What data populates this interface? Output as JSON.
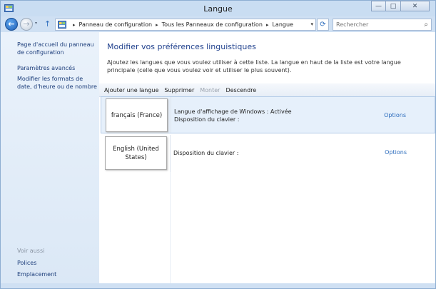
{
  "window": {
    "title": "Langue",
    "minimize": "—",
    "maximize": "□",
    "close": "✕"
  },
  "nav": {
    "back_glyph": "←",
    "forward_glyph": "→",
    "recent_glyph": "▾",
    "up_glyph": "↑",
    "refresh_glyph": "⟳",
    "breadcrumbs": [
      "Panneau de configuration",
      "Tous les Panneaux de configuration",
      "Langue"
    ],
    "separator": "▸",
    "dropdown_glyph": "▾",
    "search_placeholder": "Rechercher",
    "search_glyph": "⌕"
  },
  "sidebar": {
    "links": [
      "Page d'accueil du panneau de configuration",
      "Paramètres avancés",
      "Modifier les formats de date, d'heure ou de nombre"
    ],
    "see_also_title": "Voir aussi",
    "see_also_links": [
      "Polices",
      "Emplacement"
    ]
  },
  "main": {
    "heading": "Modifier vos préférences linguistiques",
    "description": "Ajoutez les langues que vous voulez utiliser à cette liste. La langue en haut de la liste est votre langue principale (celle que vous voulez voir et utiliser le plus souvent).",
    "toolbar": {
      "add": "Ajouter une langue",
      "remove": "Supprimer",
      "up": "Monter",
      "down": "Descendre"
    },
    "languages": [
      {
        "name": "français (France)",
        "display_language": "Langue d'affichage de Windows : Activée",
        "keyboard": "Disposition du clavier :",
        "options": "Options",
        "selected": true
      },
      {
        "name": "English (United States)",
        "keyboard": "Disposition du clavier :",
        "options": "Options",
        "selected": false
      }
    ]
  },
  "icons": [
    "control-panel-icon",
    "back-arrow-icon",
    "forward-arrow-icon",
    "up-arrow-icon",
    "refresh-icon",
    "search-icon"
  ]
}
